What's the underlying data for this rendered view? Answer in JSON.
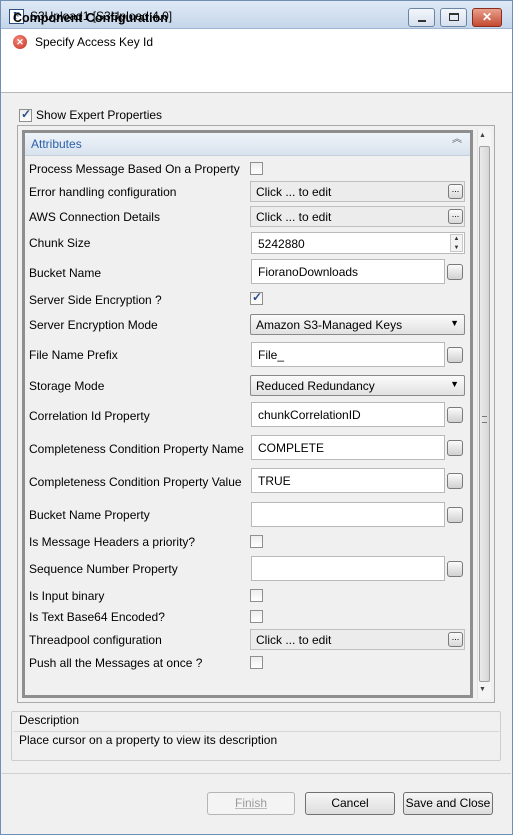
{
  "window": {
    "title": "S3Upload1 [S3Upload:4.0]",
    "app_icon_letter": "F",
    "minimize_glyph": "",
    "close_glyph": "✕"
  },
  "header": {
    "title": "Component Configuration",
    "error_message": "Specify Access Key Id",
    "error_icon": "x-icon"
  },
  "expert": {
    "label": "Show Expert Properties",
    "checked": true
  },
  "attributes": {
    "section_label": "Attributes",
    "collapse_glyph": "︽",
    "rows": {
      "process_message": {
        "label": "Process Message Based On a Property",
        "checked": false
      },
      "error_handling": {
        "label": "Error handling configuration",
        "value": "Click ... to edit"
      },
      "aws_connection": {
        "label": "AWS Connection Details",
        "value": "Click ... to edit"
      },
      "chunk_size": {
        "label": "Chunk Size",
        "value": "5242880"
      },
      "bucket_name": {
        "label": "Bucket Name",
        "value": "FioranoDownloads"
      },
      "server_side_encryption": {
        "label": "Server Side Encryption ?",
        "checked": true
      },
      "server_encryption_mode": {
        "label": "Server Encryption Mode",
        "value": "Amazon S3-Managed Keys"
      },
      "file_name_prefix": {
        "label": "File Name Prefix",
        "value": "File_"
      },
      "storage_mode": {
        "label": "Storage Mode",
        "value": "Reduced Redundancy"
      },
      "correlation_id": {
        "label": "Correlation Id Property",
        "value": "chunkCorrelationID"
      },
      "completeness_name": {
        "label": "Completeness Condition Property Name",
        "value": "COMPLETE"
      },
      "completeness_value": {
        "label": "Completeness Condition Property Value",
        "value": "TRUE"
      },
      "bucket_name_property": {
        "label": "Bucket Name Property",
        "value": ""
      },
      "message_headers_priority": {
        "label": "Is Message Headers a priority?",
        "checked": false
      },
      "sequence_number": {
        "label": "Sequence Number Property",
        "value": ""
      },
      "input_binary": {
        "label": "Is Input binary",
        "checked": false
      },
      "text_base64": {
        "label": "Is Text Base64 Encoded?",
        "checked": false
      },
      "threadpool": {
        "label": "Threadpool configuration",
        "value": "Click ... to edit"
      },
      "push_all": {
        "label": "Push all the Messages at once ?",
        "checked": false
      }
    },
    "ellipsis_glyph": "...",
    "dropdown_glyph": "▼",
    "spin_up_glyph": "▲",
    "spin_down_glyph": "▼"
  },
  "scrollbar": {
    "up_glyph": "▲",
    "down_glyph": "▼"
  },
  "description": {
    "title": "Description",
    "text": "Place cursor on a property to view its description"
  },
  "buttons": {
    "finish": "Finish",
    "cancel": "Cancel",
    "save_and_close": "Save and Close"
  },
  "colors": {
    "accent": "#2a5fa8",
    "error": "#c9301e"
  }
}
